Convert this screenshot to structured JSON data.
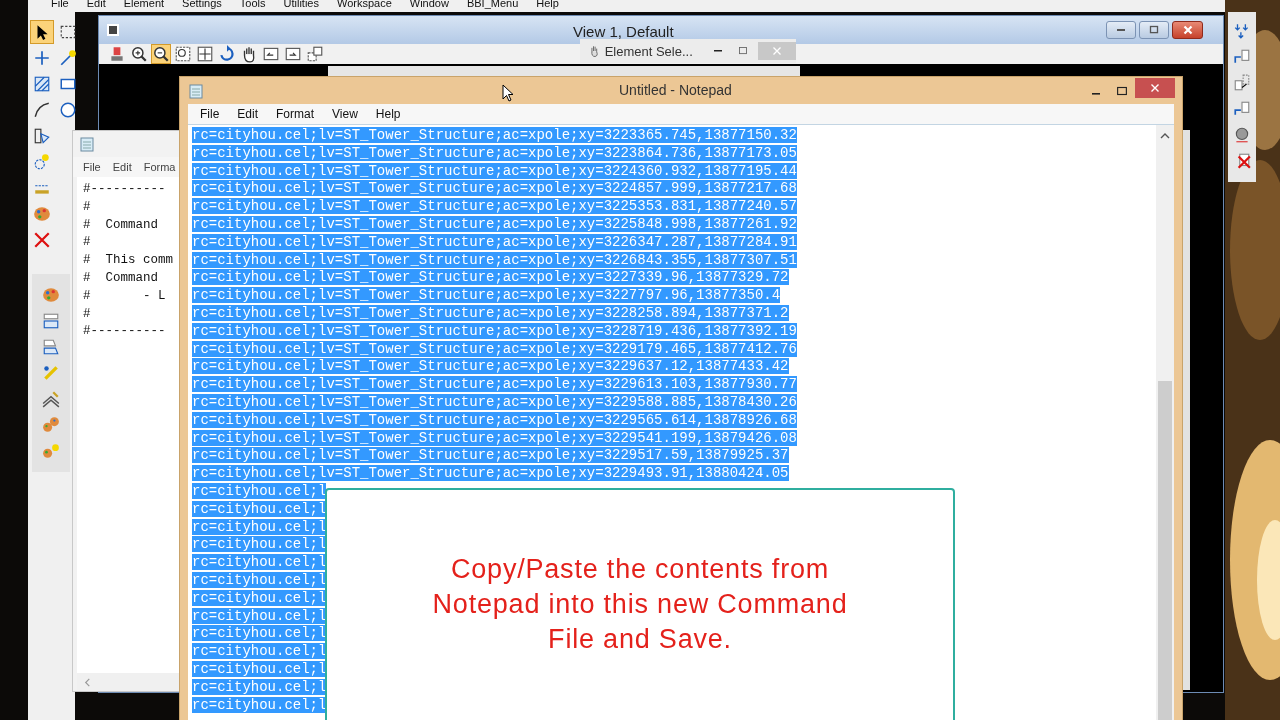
{
  "app_menu": [
    "File",
    "Edit",
    "Element",
    "Settings",
    "Tools",
    "Utilities",
    "Workspace",
    "Window",
    "BBI_Menu",
    "Help"
  ],
  "left_palette": {
    "tools": [
      {
        "selected": true
      },
      {
        "selected": false
      },
      {
        "selected": false
      },
      {
        "selected": false
      },
      {
        "selected": false
      },
      {
        "selected": false
      },
      {
        "selected": false
      },
      {
        "selected": false
      },
      {
        "selected": false
      },
      {
        "selected": false
      },
      {
        "selected": false
      },
      {
        "selected": false
      },
      {
        "selected": false
      }
    ]
  },
  "view_window": {
    "title": "View 1, Default",
    "tools": [
      {
        "selected": false
      },
      {
        "selected": false
      },
      {
        "selected": true
      },
      {
        "selected": false
      },
      {
        "selected": false
      },
      {
        "selected": false
      },
      {
        "selected": false
      },
      {
        "selected": false
      },
      {
        "selected": false
      },
      {
        "selected": false
      }
    ]
  },
  "element_selection": {
    "title": "Element Sele..."
  },
  "command_file_window": {
    "menu": [
      "File",
      "Edit",
      "Forma"
    ],
    "lines": [
      "#----------",
      "#",
      "#  Command",
      "#",
      "#  This comm",
      "#  Command",
      "#       - L",
      "#",
      "#----------"
    ]
  },
  "notepad": {
    "title": "Untitled - Notepad",
    "menu": [
      "File",
      "Edit",
      "Format",
      "View",
      "Help"
    ],
    "lines": [
      {
        "text": "rc=cityhou.cel;lv=ST_Tower_Structure;ac=xpole;xy=3223365.745,13877150.32",
        "selected": true
      },
      {
        "text": "rc=cityhou.cel;lv=ST_Tower_Structure;ac=xpole;xy=3223864.736,13877173.05",
        "selected": true
      },
      {
        "text": "rc=cityhou.cel;lv=ST_Tower_Structure;ac=xpole;xy=3224360.932,13877195.44",
        "selected": true
      },
      {
        "text": "rc=cityhou.cel;lv=ST_Tower_Structure;ac=xpole;xy=3224857.999,13877217.68",
        "selected": true
      },
      {
        "text": "rc=cityhou.cel;lv=ST_Tower_Structure;ac=xpole;xy=3225353.831,13877240.57",
        "selected": true
      },
      {
        "text": "rc=cityhou.cel;lv=ST_Tower_Structure;ac=xpole;xy=3225848.998,13877261.92",
        "selected": true
      },
      {
        "text": "rc=cityhou.cel;lv=ST_Tower_Structure;ac=xpole;xy=3226347.287,13877284.91",
        "selected": true
      },
      {
        "text": "rc=cityhou.cel;lv=ST_Tower_Structure;ac=xpole;xy=3226843.355,13877307.51",
        "selected": true
      },
      {
        "text": "rc=cityhou.cel;lv=ST_Tower_Structure;ac=xpole;xy=3227339.96,13877329.72",
        "selected": true
      },
      {
        "text": "rc=cityhou.cel;lv=ST_Tower_Structure;ac=xpole;xy=3227797.96,13877350.4",
        "selected": true
      },
      {
        "text": "rc=cityhou.cel;lv=ST_Tower_Structure;ac=xpole;xy=3228258.894,13877371.2",
        "selected": true
      },
      {
        "text": "rc=cityhou.cel;lv=ST_Tower_Structure;ac=xpole;xy=3228719.436,13877392.19",
        "selected": true
      },
      {
        "text": "rc=cityhou.cel;lv=ST_Tower_Structure;ac=xpole;xy=3229179.465,13877412.76",
        "selected": true
      },
      {
        "text": "rc=cityhou.cel;lv=ST_Tower_Structure;ac=xpole;xy=3229637.12,13877433.42",
        "selected": true
      },
      {
        "text": "rc=cityhou.cel;lv=ST_Tower_Structure;ac=xpole;xy=3229613.103,13877930.77",
        "selected": true
      },
      {
        "text": "rc=cityhou.cel;lv=ST_Tower_Structure;ac=xpole;xy=3229588.885,13878430.26",
        "selected": true
      },
      {
        "text": "rc=cityhou.cel;lv=ST_Tower_Structure;ac=xpole;xy=3229565.614,13878926.68",
        "selected": true
      },
      {
        "text": "rc=cityhou.cel;lv=ST_Tower_Structure;ac=xpole;xy=3229541.199,13879426.08",
        "selected": true
      },
      {
        "text": "rc=cityhou.cel;lv=ST_Tower_Structure;ac=xpole;xy=3229517.59,13879925.37",
        "selected": true
      },
      {
        "text": "rc=cityhou.cel;lv=ST_Tower_Structure;ac=xpole;xy=3229493.91,13880424.05",
        "selected": true
      },
      {
        "text": "rc=cityhou.cel;l",
        "selected": true
      },
      {
        "text": "rc=cityhou.cel;l",
        "selected": true
      },
      {
        "text": "rc=cityhou.cel;l",
        "selected": true
      },
      {
        "text": "rc=cityhou.cel;l",
        "selected": true
      },
      {
        "text": "rc=cityhou.cel;l",
        "selected": true
      },
      {
        "text": "rc=cityhou.cel;l",
        "selected": true
      },
      {
        "text": "rc=cityhou.cel;l",
        "selected": true
      },
      {
        "text": "rc=cityhou.cel;l",
        "selected": true
      },
      {
        "text": "rc=cityhou.cel;l",
        "selected": true
      },
      {
        "text": "rc=cityhou.cel;l",
        "selected": true
      },
      {
        "text": "rc=cityhou.cel;l",
        "selected": true
      },
      {
        "text": "rc=cityhou.cel;l",
        "selected": true
      },
      {
        "text": "rc=cityhou.cel;l",
        "selected": true
      }
    ]
  },
  "callout": {
    "text": "Copy/Paste the contents from Notepad into this new Command File and Save."
  }
}
